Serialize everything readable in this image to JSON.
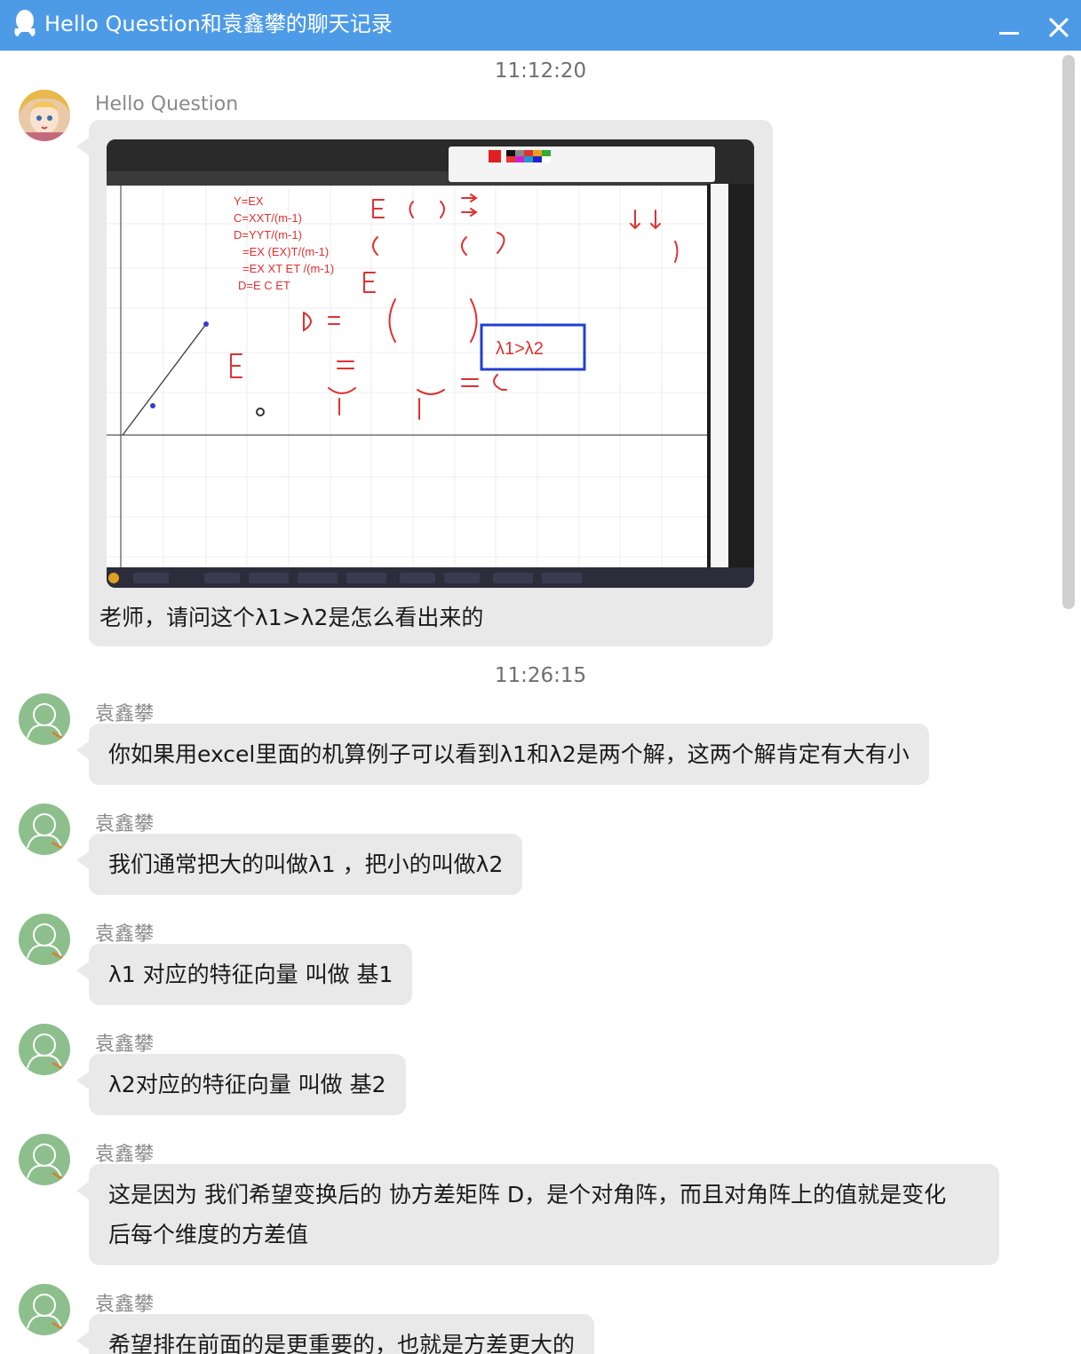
{
  "window": {
    "title": "Hello Question和袁鑫攀的聊天记录",
    "minimize_icon": "minimize-icon",
    "close_icon": "close-icon"
  },
  "colors": {
    "titlebar": "#4d9be6",
    "bubble": "#e9e9e9",
    "timestamp": "#6f6f6f",
    "sender": "#8a8a8a"
  },
  "messages_group1": {
    "timestamp": "11:12:20",
    "sender": "Hello Question",
    "image_caption": "老师，请问这个λ1>λ2是怎么看出来的",
    "image_icon": "screenshot-image",
    "image_text": {
      "typed": [
        "Y=EX",
        "C=XXT/(m-1)",
        "D=YYT/(m-1)",
        "=EX (EX)T/(m-1)",
        "=EX XT ET /(m-1)",
        "D=E C ET"
      ],
      "boxed": "λ1>λ2"
    }
  },
  "messages_group2": {
    "timestamp": "11:26:15",
    "sender": "袁鑫攀",
    "messages": [
      "你如果用excel里面的机算例子可以看到λ1和λ2是两个解，这两个解肯定有大有小",
      "我们通常把大的叫做λ1 ，把小的叫做λ2",
      "λ1 对应的特征向量 叫做 基1",
      "λ2对应的特征向量 叫做 基2",
      "这是因为 我们希望变换后的 协方差矩阵 D，是个对角阵，而且对角阵上的值就是变化",
      "后每个维度的方差值",
      "希望排在前面的是更重要的，也就是方差更大的"
    ]
  }
}
